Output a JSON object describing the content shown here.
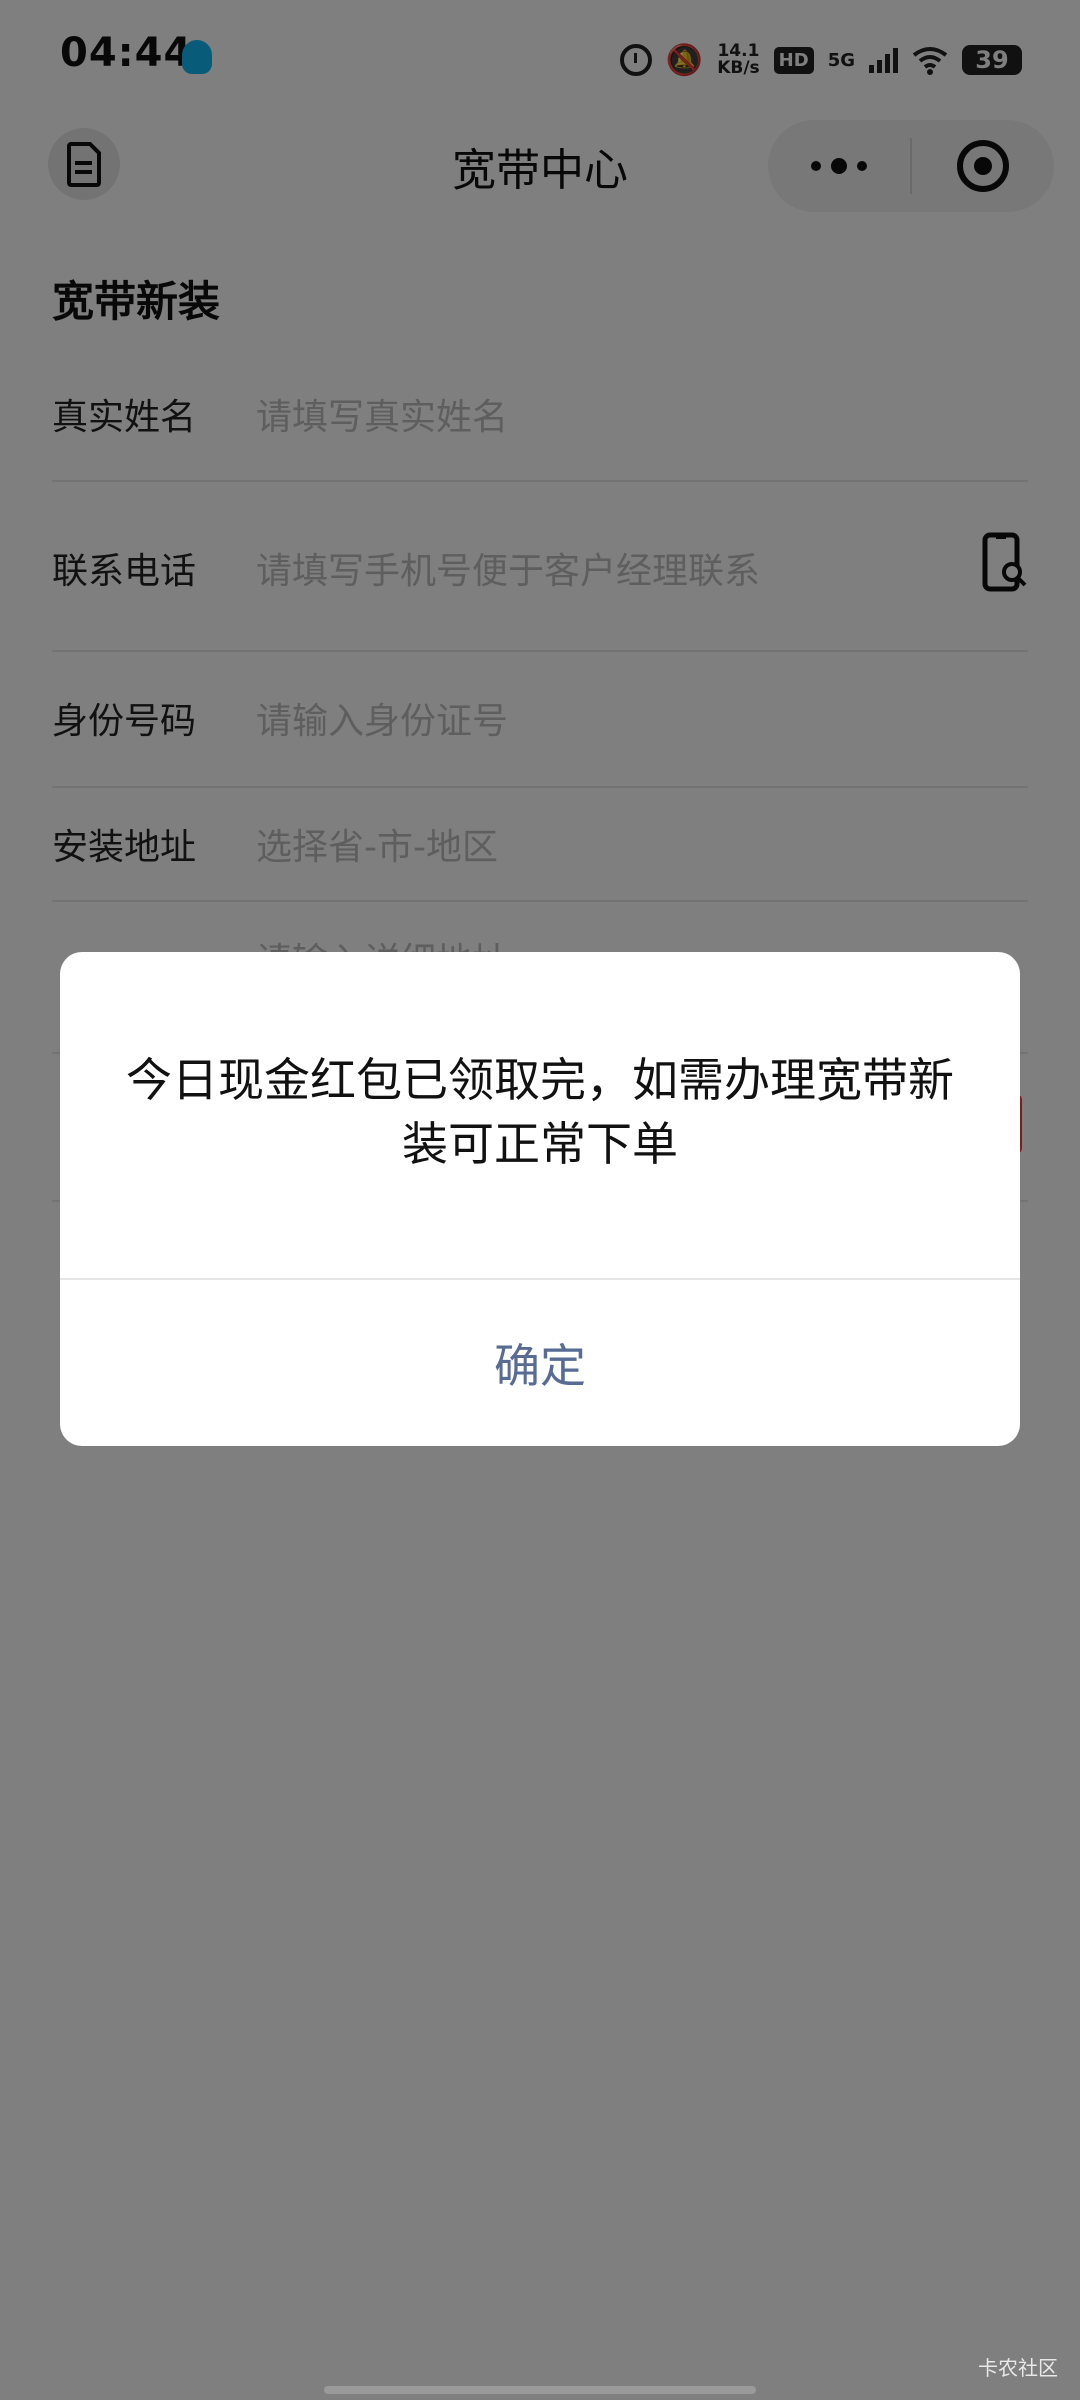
{
  "status_bar": {
    "time": "04:44",
    "speed_value": "14.1",
    "speed_unit": "KB/s",
    "hd_label": "HD",
    "network_label": "5G",
    "battery": "39",
    "icons": [
      "qq-icon",
      "alarm-icon",
      "mute-bell-icon",
      "signal-bars-icon",
      "wifi-icon",
      "battery-icon"
    ]
  },
  "nav": {
    "title": "宽带中心",
    "left_icon": "document-icon",
    "capsule_icons": [
      "more-icon",
      "close-target-icon"
    ]
  },
  "form": {
    "section_title": "宽带新装",
    "rows": [
      {
        "label": "真实姓名",
        "placeholder": "请填写真实姓名"
      },
      {
        "label": "联系电话",
        "placeholder": "请填写手机号便于客户经理联系"
      },
      {
        "label": "身份号码",
        "placeholder": "请输入身份证号"
      },
      {
        "label": "安装地址",
        "placeholder": "选择省-市-地区"
      },
      {
        "label": "",
        "placeholder": "请输入详细地址"
      },
      {
        "label": ""
      }
    ]
  },
  "modal": {
    "message": "今日现金红包已领取完，如需办理宽带新装可正常下单",
    "confirm_label": "确定"
  },
  "watermark": "卡农社区",
  "colors": {
    "overlay": "#000000",
    "dialog_button": "#576b95",
    "placeholder": "#bdbdbd",
    "qq_blue": "#12b7f5"
  }
}
